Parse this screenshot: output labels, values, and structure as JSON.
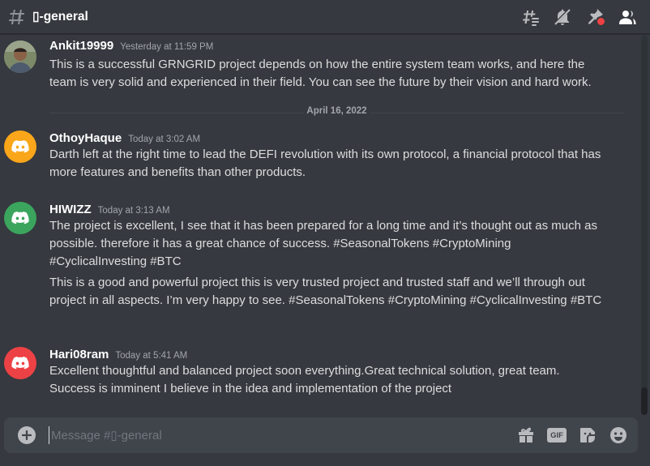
{
  "channel": {
    "name": "▯-general",
    "input_placeholder": "Message #▯-general"
  },
  "colors": {
    "background": "#36393f",
    "composer": "#40444b",
    "avatar_orange": "#faa61a",
    "avatar_green": "#3ba55d",
    "avatar_red": "#ed4245"
  },
  "header_icons": [
    "threads-icon",
    "muted-bell-icon",
    "pin-icon",
    "members-icon"
  ],
  "composer_icons": [
    "add-attachment-icon",
    "gift-icon",
    "gif-icon",
    "sticker-icon",
    "emoji-icon"
  ],
  "composer_gif_label": "GIF",
  "messages": [
    {
      "author": "Ankit19999",
      "timestamp": "Yesterday at 11:59 PM",
      "avatar": "photo",
      "paragraphs": [
        "This is a successful GRNGRID project depends on how the entire system team works, and here the team is very solid and experienced in their field. You can see the future by their vision and hard work."
      ]
    },
    {
      "author": "OthoyHaque",
      "timestamp": "Today at 3:02 AM",
      "avatar": "discord-orange",
      "paragraphs": [
        "Darth left at the right time to lead the DEFI revolution with its own protocol, a financial protocol that has more features and benefits than other products."
      ]
    },
    {
      "author": "HIWIZZ",
      "timestamp": "Today at 3:13 AM",
      "avatar": "discord-green",
      "paragraphs": [
        "The project is excellent, I see that it has been prepared for a long time and it’s thought out as much as possible. therefore it has a great chance of success. #SeasonalTokens #CryptoMining #CyclicalInvesting #BTC",
        "This is a good and powerful project this is very trusted project and trusted staff and we’ll through out project in all aspects. I’m very happy to see. #SeasonalTokens #CryptoMining #CyclicalInvesting #BTC"
      ]
    },
    {
      "author": "Hari08ram",
      "timestamp": "Today at 5:41 AM",
      "avatar": "discord-red",
      "paragraphs": [
        "Excellent thoughtful and balanced project soon everything.Great technical solution, great team. Success is imminent I believe in the idea and implementation of the project"
      ]
    }
  ],
  "date_divider": "April 16, 2022"
}
